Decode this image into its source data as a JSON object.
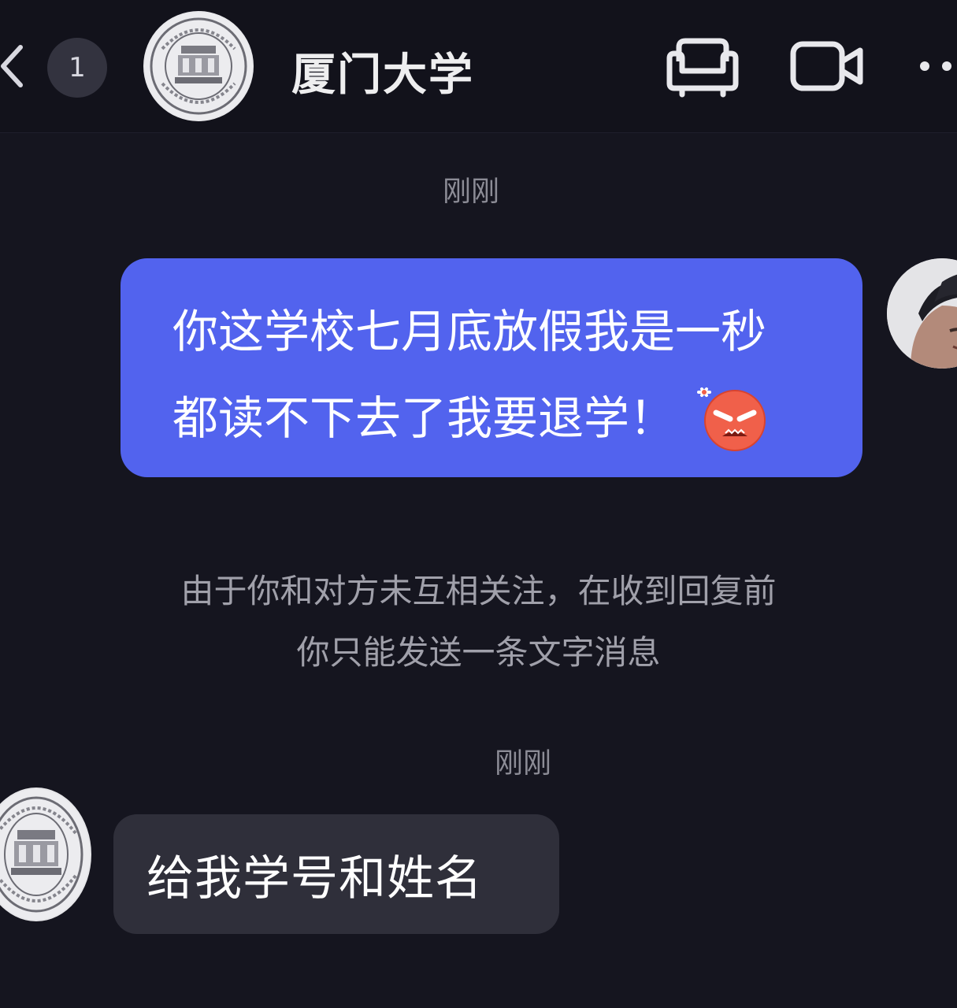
{
  "header": {
    "back_icon": "chevron-left-icon",
    "unread_count": "1",
    "avatar": "university-seal",
    "title": "厦门大学",
    "sofa_icon": "sofa-icon",
    "video_icon": "video-camera-icon",
    "more_icon": "more-dots-icon"
  },
  "messages": {
    "timestamp_1": "刚刚",
    "outgoing": {
      "line_1": "你这学校七月底放假我是一秒",
      "line_2": "都读不下去了我要退学！",
      "emoji": "angry-face-icon"
    },
    "notice": {
      "line_1": "由于你和对方未互相关注，在收到回复前",
      "line_2": "你只能发送一条文字消息"
    },
    "timestamp_2": "刚刚",
    "incoming": {
      "text": "给我学号和姓名"
    }
  },
  "colors": {
    "background": "#15151f",
    "outgoing_bubble": "#5263ee",
    "incoming_bubble": "#2f2f3a",
    "muted_text": "#8c8c96"
  }
}
